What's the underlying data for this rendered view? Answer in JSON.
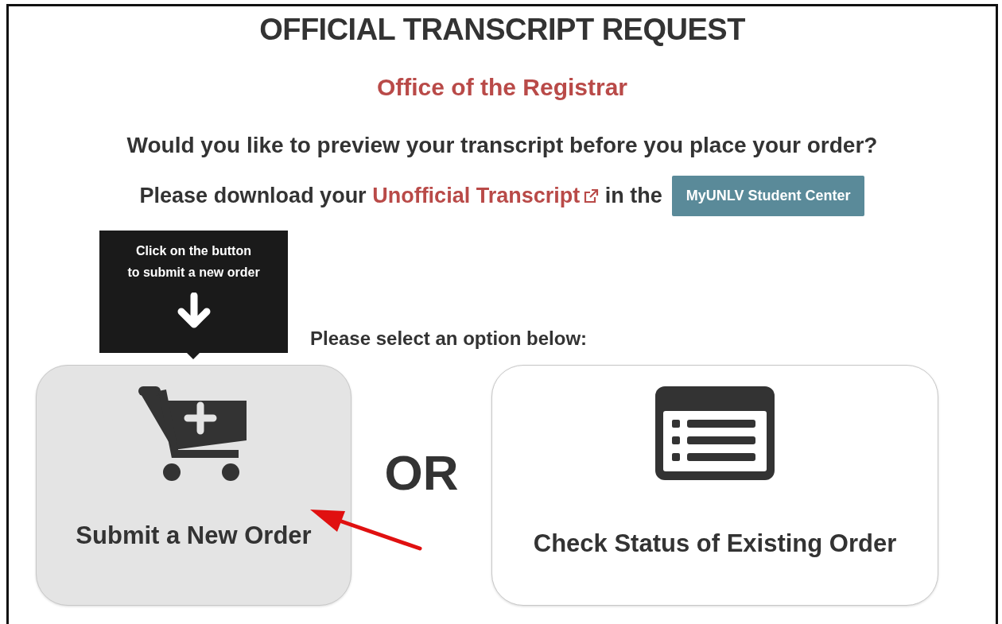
{
  "title": "OFFICIAL TRANSCRIPT REQUEST",
  "subtitle": "Office of the Registrar",
  "preview_question": "Would you like to preview your transcript before you place your order?",
  "download_line": {
    "prefix": "Please download your",
    "link": "Unofficial Transcript",
    "suffix": "in the",
    "button": "MyUNLV Student Center"
  },
  "tooltip": {
    "lines": [
      "Click on the button",
      "to submit a new order"
    ]
  },
  "select_prompt": "Please select an option below:",
  "options": [
    {
      "kind": "cart",
      "label": "Submit a New Order",
      "highlighted": true
    },
    {
      "kind": "list",
      "label": "Check Status of Existing Order",
      "highlighted": false
    }
  ],
  "separator": "OR"
}
